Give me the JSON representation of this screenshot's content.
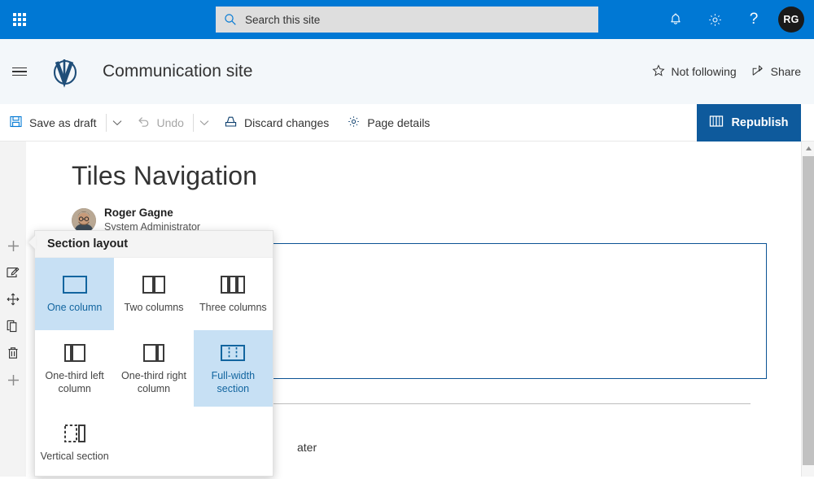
{
  "suitebar": {
    "waffle_label": "App launcher",
    "search": {
      "placeholder": "Search this site",
      "value": ""
    },
    "notifications_label": "Notifications",
    "settings_label": "Settings",
    "help_label": "Help",
    "avatar_initials": "RG",
    "background_color": "#0078d4"
  },
  "siteheader": {
    "nav_toggle_label": "Site navigation",
    "site_title": "Communication site",
    "follow_label": "Not following",
    "share_label": "Share",
    "background_color": "#f3f7fa"
  },
  "commandbar": {
    "save_as_draft_label": "Save as draft",
    "save_chevron_label": "Save options",
    "undo_label": "Undo",
    "undo_chevron_label": "Undo options",
    "discard_changes_label": "Discard changes",
    "page_details_label": "Page details",
    "republish_label": "Republish",
    "republish_color": "#0e5a9c"
  },
  "page": {
    "title": "Tiles Navigation",
    "author_name": "Roger Gagne",
    "author_role": "System Administrator",
    "tail_text": "ater",
    "selected_section_border_color": "#0b5394"
  },
  "rail": {
    "add_section_top_label": "Add a new section",
    "edit_section_label": "Edit section",
    "move_section_label": "Move section",
    "duplicate_section_label": "Duplicate section",
    "delete_section_label": "Delete section",
    "add_section_bottom_label": "Add a new section"
  },
  "callout": {
    "heading": "Section layout",
    "selected_color": "#c7e0f4",
    "selected_text_color": "#12659f",
    "options": [
      {
        "label": "One column",
        "icon": "one-column-icon",
        "state": "selected"
      },
      {
        "label": "Two columns",
        "icon": "two-columns-icon",
        "state": "normal"
      },
      {
        "label": "Three columns",
        "icon": "three-columns-icon",
        "state": "normal"
      },
      {
        "label": "One-third left column",
        "icon": "one-third-left-icon",
        "state": "normal"
      },
      {
        "label": "One-third right column",
        "icon": "one-third-right-icon",
        "state": "normal"
      },
      {
        "label": "Full-width section",
        "icon": "full-width-icon",
        "state": "hovered"
      },
      {
        "label": "Vertical section",
        "icon": "vertical-section-icon",
        "state": "normal"
      }
    ]
  },
  "scrollbar": {
    "up_label": "Scroll up"
  }
}
